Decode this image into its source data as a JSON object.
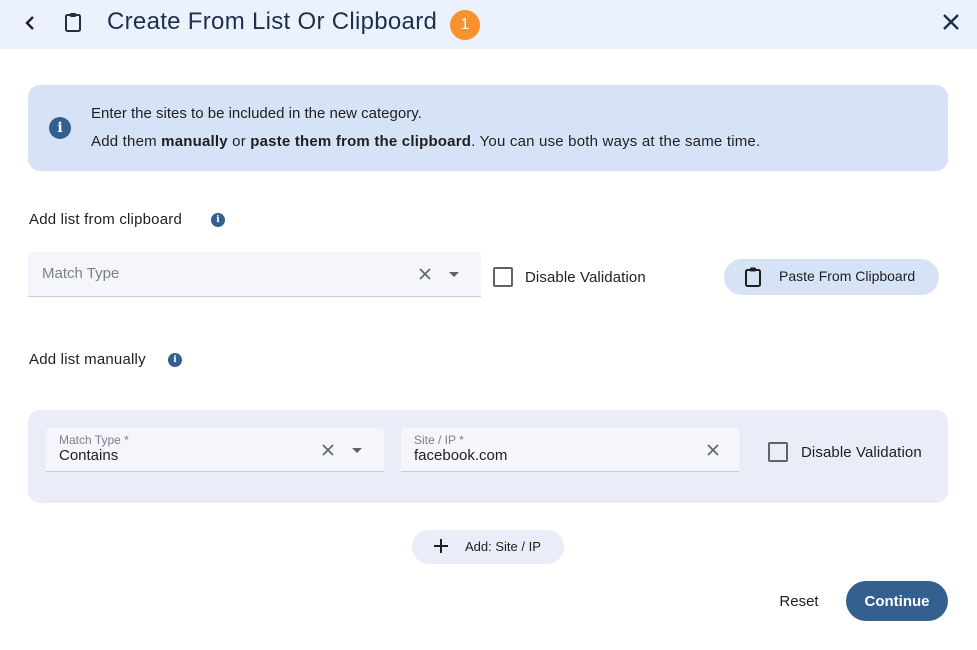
{
  "header": {
    "title": "Create From List Or Clipboard",
    "badge_count": "1",
    "back_icon": "chevron-left-icon",
    "title_icon": "clipboard-icon",
    "close_icon": "close-icon"
  },
  "info": {
    "line1": "Enter the sites to be included in the new category.",
    "line2_prefix": "Add them ",
    "line2_bold1": "manually",
    "line2_mid": " or ",
    "line2_bold2": "paste them from the clipboard",
    "line2_suffix": ". You can use both ways at the same time.",
    "icon": "info-icon"
  },
  "clipboard_section": {
    "label": "Add list from clipboard",
    "match_type_placeholder": "Match Type",
    "disable_validation_label": "Disable Validation",
    "disable_validation_checked": false,
    "paste_button_label": "Paste From Clipboard"
  },
  "manual_section": {
    "label": "Add list manually",
    "rows": [
      {
        "match_type_label": "Match Type *",
        "match_type_value": "Contains",
        "site_label": "Site / IP *",
        "site_value": "facebook.com",
        "disable_validation_label": "Disable Validation",
        "disable_validation_checked": false
      }
    ],
    "add_button_label": "Add: Site / IP"
  },
  "footer": {
    "reset_label": "Reset",
    "continue_label": "Continue"
  },
  "colors": {
    "header_bg": "#ecf2fd",
    "info_bg": "#d6e3f7",
    "primary": "#33608f",
    "badge": "#f7922e",
    "manual_bg": "#eaecf8"
  }
}
